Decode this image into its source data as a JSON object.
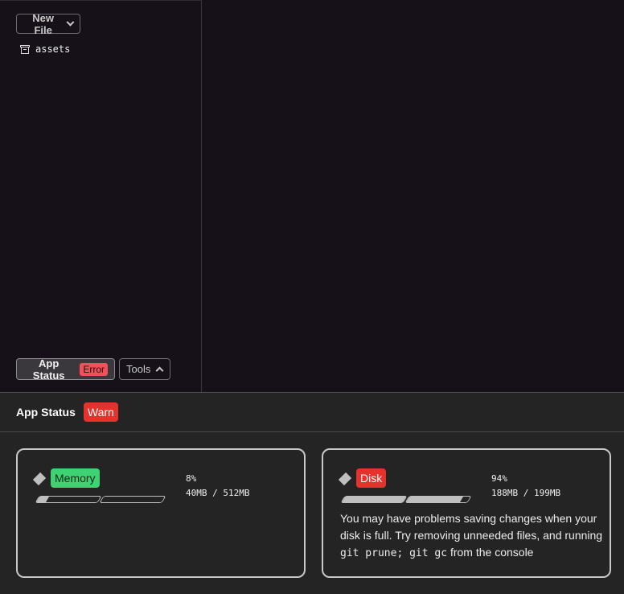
{
  "sidebar": {
    "new_file_label": "New File",
    "tree": [
      {
        "icon": "archive-folder-icon",
        "label": "assets"
      }
    ],
    "app_status_label": "App Status",
    "app_status_badge": "Error",
    "tools_label": "Tools"
  },
  "panel": {
    "title": "App Status",
    "badge": "Warn",
    "colors": {
      "warn": "#e5322d",
      "ok": "#3fd272",
      "error_badge": "#f2505a"
    },
    "memory": {
      "label": "Memory",
      "percent_text": "8%",
      "usage_text": "40MB / 512MB",
      "percent": 0.08
    },
    "disk": {
      "label": "Disk",
      "percent_text": "94%",
      "usage_text": "188MB / 199MB",
      "percent": 0.94,
      "message_pre": "You may have problems saving changes when your disk is full. Try removing unneeded files, and running ",
      "message_code1": "git prune",
      "message_sep": "; ",
      "message_code2": "git gc",
      "message_post": " from the console"
    }
  }
}
